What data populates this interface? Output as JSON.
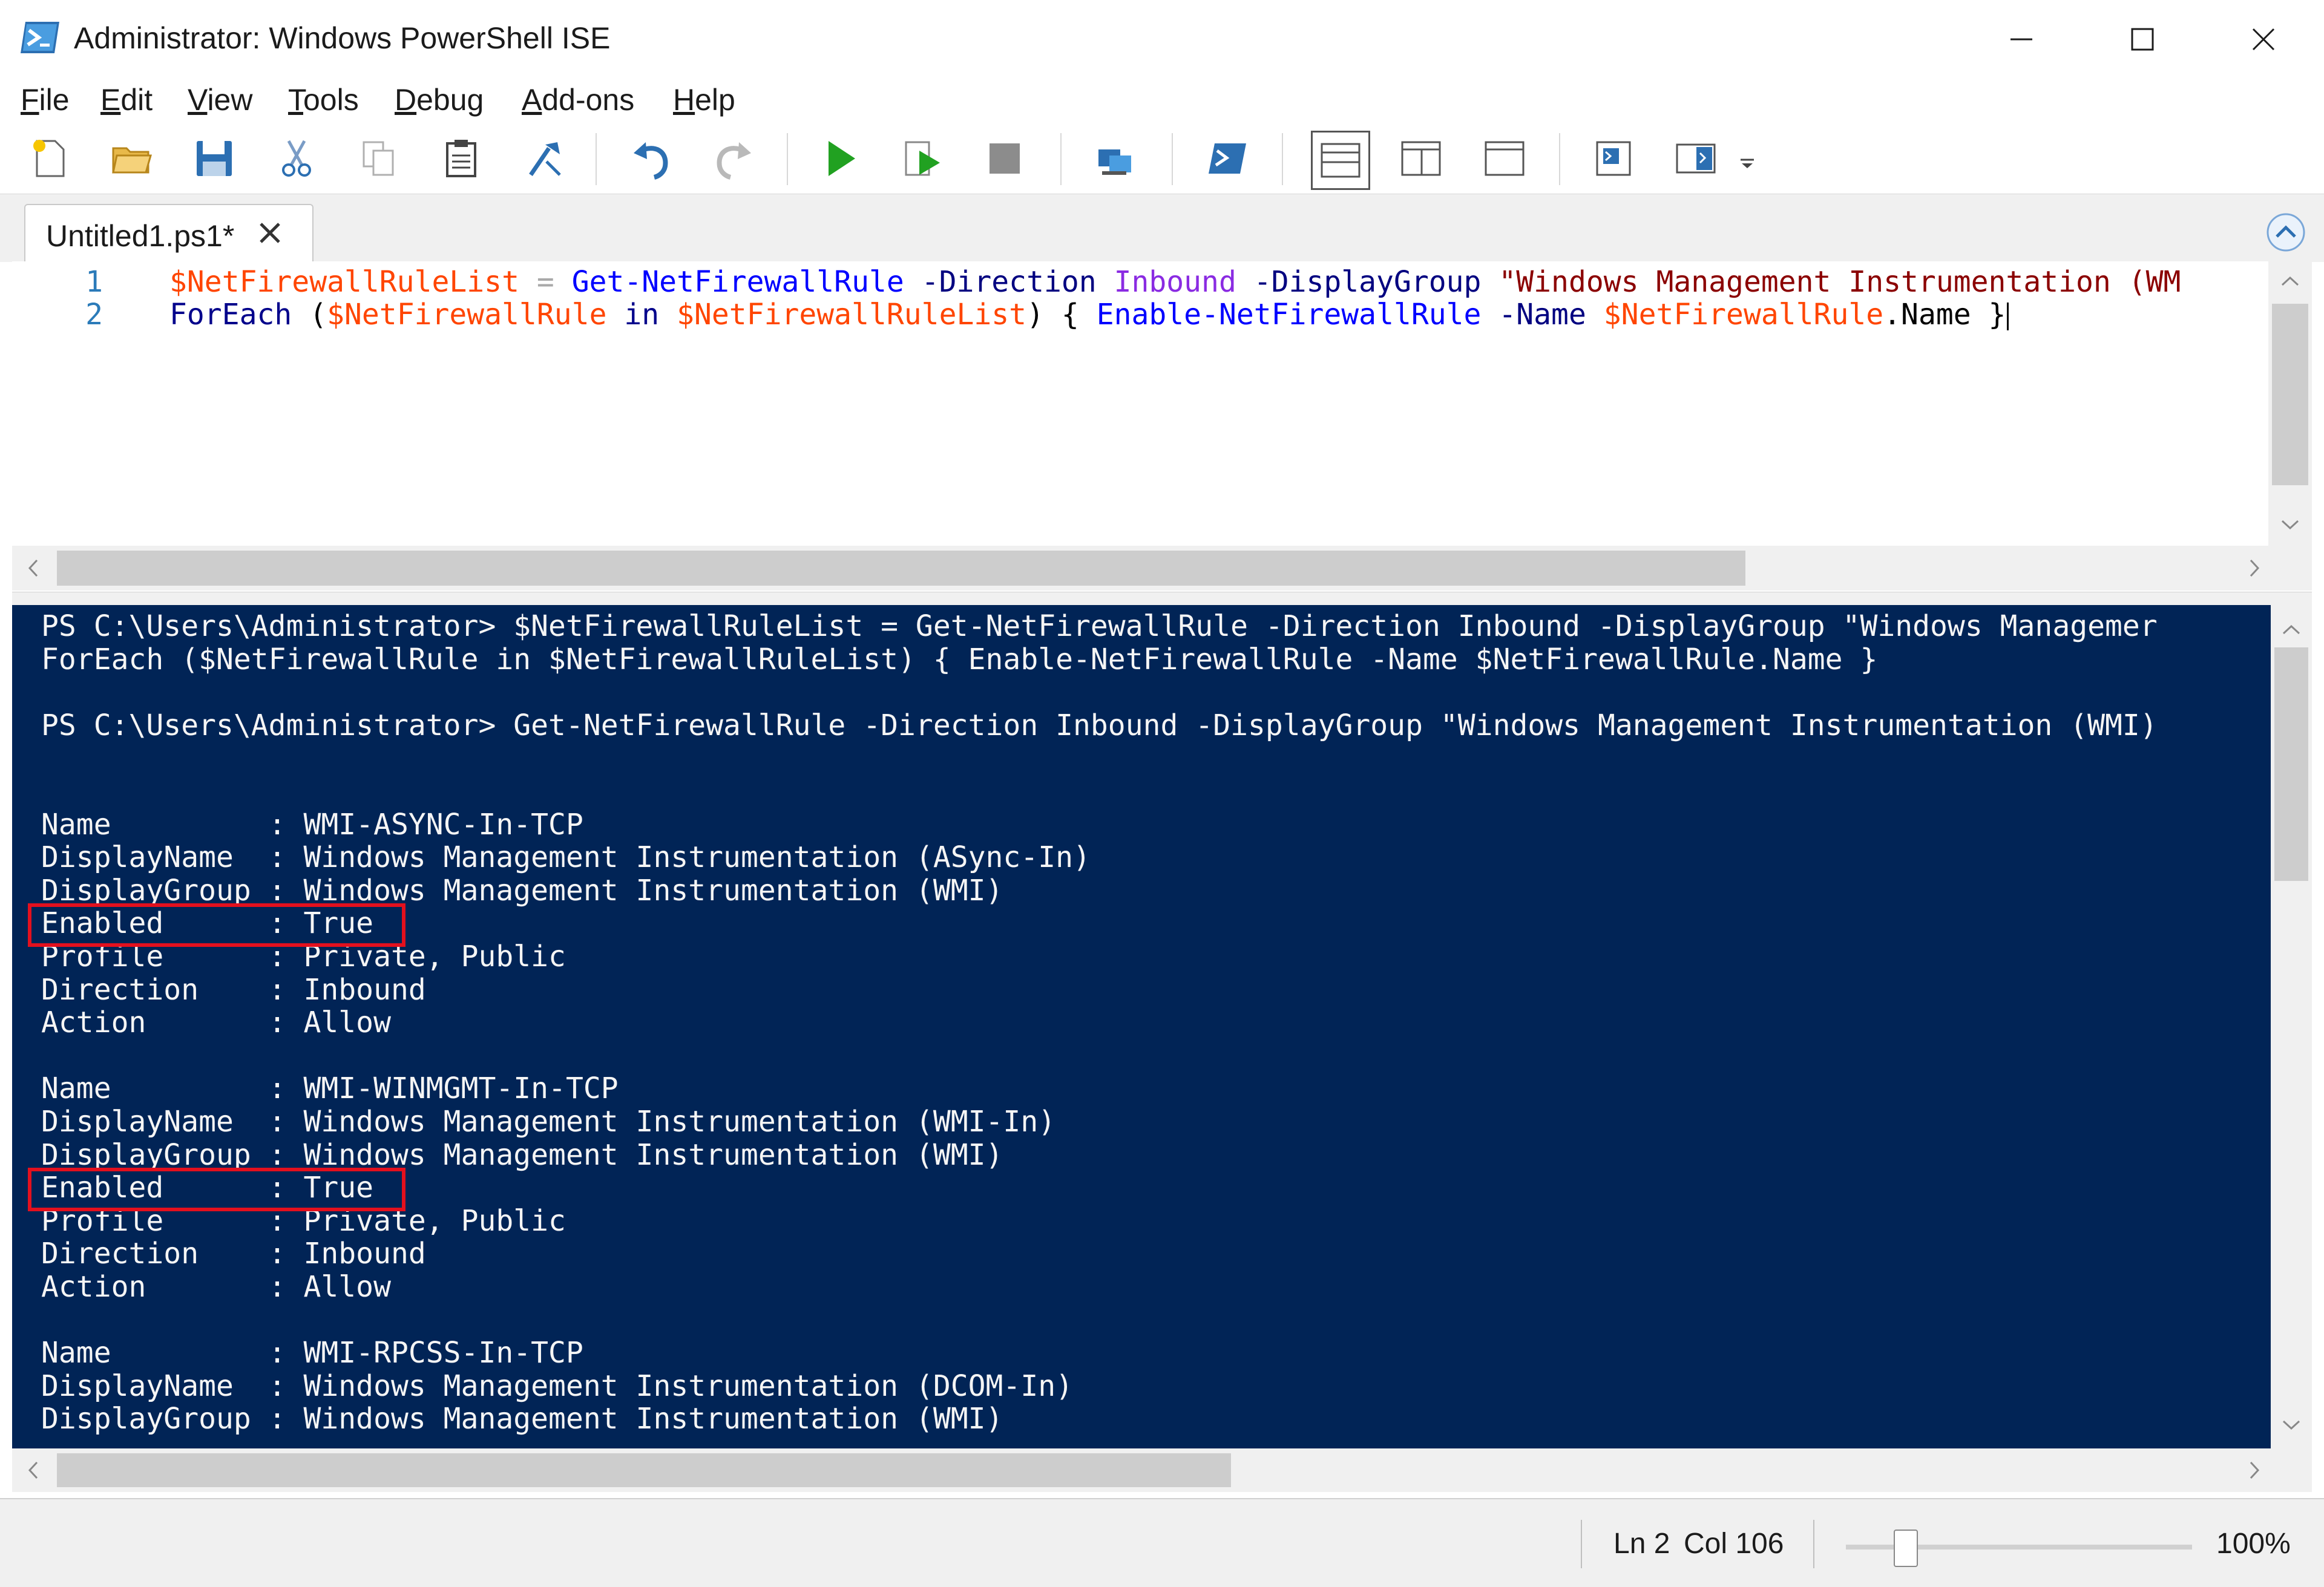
{
  "window": {
    "title": "Administrator: Windows PowerShell ISE"
  },
  "menu": {
    "items": [
      {
        "key": "F",
        "rest": "ile"
      },
      {
        "key": "E",
        "rest": "dit"
      },
      {
        "key": "V",
        "rest": "iew"
      },
      {
        "key": "T",
        "rest": "ools"
      },
      {
        "key": "D",
        "rest": "ebug"
      },
      {
        "key": "A",
        "rest": "dd-ons"
      },
      {
        "key": "H",
        "rest": "elp"
      }
    ]
  },
  "toolbar": {
    "buttons": [
      "new",
      "open",
      "save",
      "cut",
      "copy",
      "paste",
      "clear",
      "undo",
      "redo",
      "run",
      "run-selection",
      "stop",
      "new-remote",
      "start-powershell",
      "show-script-top",
      "show-script-right",
      "show-script-max",
      "show-commands",
      "show-addon"
    ]
  },
  "tabs": [
    {
      "label": "Untitled1.ps1*"
    }
  ],
  "editor": {
    "lines": [
      {
        "num": "1",
        "tokens": [
          {
            "t": "$NetFirewallRuleList",
            "c": "var"
          },
          {
            "t": " ",
            "c": "mem"
          },
          {
            "t": "=",
            "c": "op"
          },
          {
            "t": " ",
            "c": "mem"
          },
          {
            "t": "Get-NetFirewallRule",
            "c": "cmd"
          },
          {
            "t": " ",
            "c": "mem"
          },
          {
            "t": "-Direction",
            "c": "param"
          },
          {
            "t": " ",
            "c": "mem"
          },
          {
            "t": "Inbound",
            "c": "arg"
          },
          {
            "t": " ",
            "c": "mem"
          },
          {
            "t": "-DisplayGroup",
            "c": "param"
          },
          {
            "t": " ",
            "c": "mem"
          },
          {
            "t": "\"Windows Management Instrumentation (WM",
            "c": "str"
          }
        ]
      },
      {
        "num": "2",
        "tokens": [
          {
            "t": "ForEach",
            "c": "kw"
          },
          {
            "t": " ",
            "c": "mem"
          },
          {
            "t": "(",
            "c": "mem"
          },
          {
            "t": "$NetFirewallRule",
            "c": "var"
          },
          {
            "t": " ",
            "c": "mem"
          },
          {
            "t": "in",
            "c": "kw"
          },
          {
            "t": " ",
            "c": "mem"
          },
          {
            "t": "$NetFirewallRuleList",
            "c": "var"
          },
          {
            "t": ")",
            "c": "mem"
          },
          {
            "t": " ",
            "c": "mem"
          },
          {
            "t": "{",
            "c": "mem"
          },
          {
            "t": " ",
            "c": "mem"
          },
          {
            "t": "Enable-NetFirewallRule",
            "c": "cmd"
          },
          {
            "t": " ",
            "c": "mem"
          },
          {
            "t": "-Name",
            "c": "param"
          },
          {
            "t": " ",
            "c": "mem"
          },
          {
            "t": "$NetFirewallRule",
            "c": "var"
          },
          {
            "t": ".Name",
            "c": "mem"
          },
          {
            "t": " ",
            "c": "mem"
          },
          {
            "t": "}",
            "c": "mem"
          }
        ]
      }
    ]
  },
  "console": {
    "lines": [
      "PS C:\\Users\\Administrator> $NetFirewallRuleList = Get-NetFirewallRule -Direction Inbound -DisplayGroup \"Windows Managemer",
      "ForEach ($NetFirewallRule in $NetFirewallRuleList) { Enable-NetFirewallRule -Name $NetFirewallRule.Name }",
      "",
      "PS C:\\Users\\Administrator> Get-NetFirewallRule -Direction Inbound -DisplayGroup \"Windows Management Instrumentation (WMI)",
      "",
      "",
      "Name         : WMI-ASYNC-In-TCP",
      "DisplayName  : Windows Management Instrumentation (ASync-In)",
      "DisplayGroup : Windows Management Instrumentation (WMI)",
      "Enabled      : True",
      "Profile      : Private, Public",
      "Direction    : Inbound",
      "Action       : Allow",
      "",
      "Name         : WMI-WINMGMT-In-TCP",
      "DisplayName  : Windows Management Instrumentation (WMI-In)",
      "DisplayGroup : Windows Management Instrumentation (WMI)",
      "Enabled      : True",
      "Profile      : Private, Public",
      "Direction    : Inbound",
      "Action       : Allow",
      "",
      "Name         : WMI-RPCSS-In-TCP",
      "DisplayName  : Windows Management Instrumentation (DCOM-In)",
      "DisplayGroup : Windows Management Instrumentation (WMI)"
    ],
    "highlighted_lines": [
      9,
      17
    ]
  },
  "status": {
    "ln": "Ln 2",
    "col": "Col 106",
    "zoom": "100%",
    "zoom_fraction": 0.17
  },
  "colors": {
    "console_bg": "#012456",
    "highlight": "#e3101e"
  }
}
